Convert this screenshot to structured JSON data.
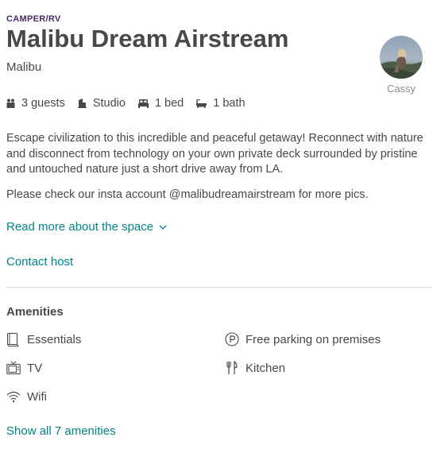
{
  "listing": {
    "category": "CAMPER/RV",
    "title": "Malibu Dream Airstream",
    "location": "Malibu"
  },
  "host": {
    "name": "Cassy"
  },
  "facts": [
    {
      "icon": "guests-icon",
      "label": "3 guests"
    },
    {
      "icon": "home-icon",
      "label": "Studio"
    },
    {
      "icon": "bed-icon",
      "label": "1 bed"
    },
    {
      "icon": "bath-icon",
      "label": "1 bath"
    }
  ],
  "description": {
    "paragraph1": "Escape civilization to this incredible and peaceful getaway! Reconnect with nature and disconnect from technology on your own private deck surrounded by pristine and untouched nature just a short drive away from LA.",
    "paragraph2": "Please check our insta account @malibudreamairstream for more pics."
  },
  "links": {
    "read_more": "Read more about the space",
    "contact_host": "Contact host",
    "show_all_amenities": "Show all 7 amenities"
  },
  "amenities": {
    "title": "Amenities",
    "items": [
      {
        "icon": "essentials-icon",
        "label": "Essentials"
      },
      {
        "icon": "parking-icon",
        "label": "Free parking on premises"
      },
      {
        "icon": "tv-icon",
        "label": "TV"
      },
      {
        "icon": "kitchen-icon",
        "label": "Kitchen"
      },
      {
        "icon": "wifi-icon",
        "label": "Wifi"
      }
    ]
  },
  "colors": {
    "link": "#008489",
    "category": "#4a2a63",
    "text": "#484848"
  }
}
